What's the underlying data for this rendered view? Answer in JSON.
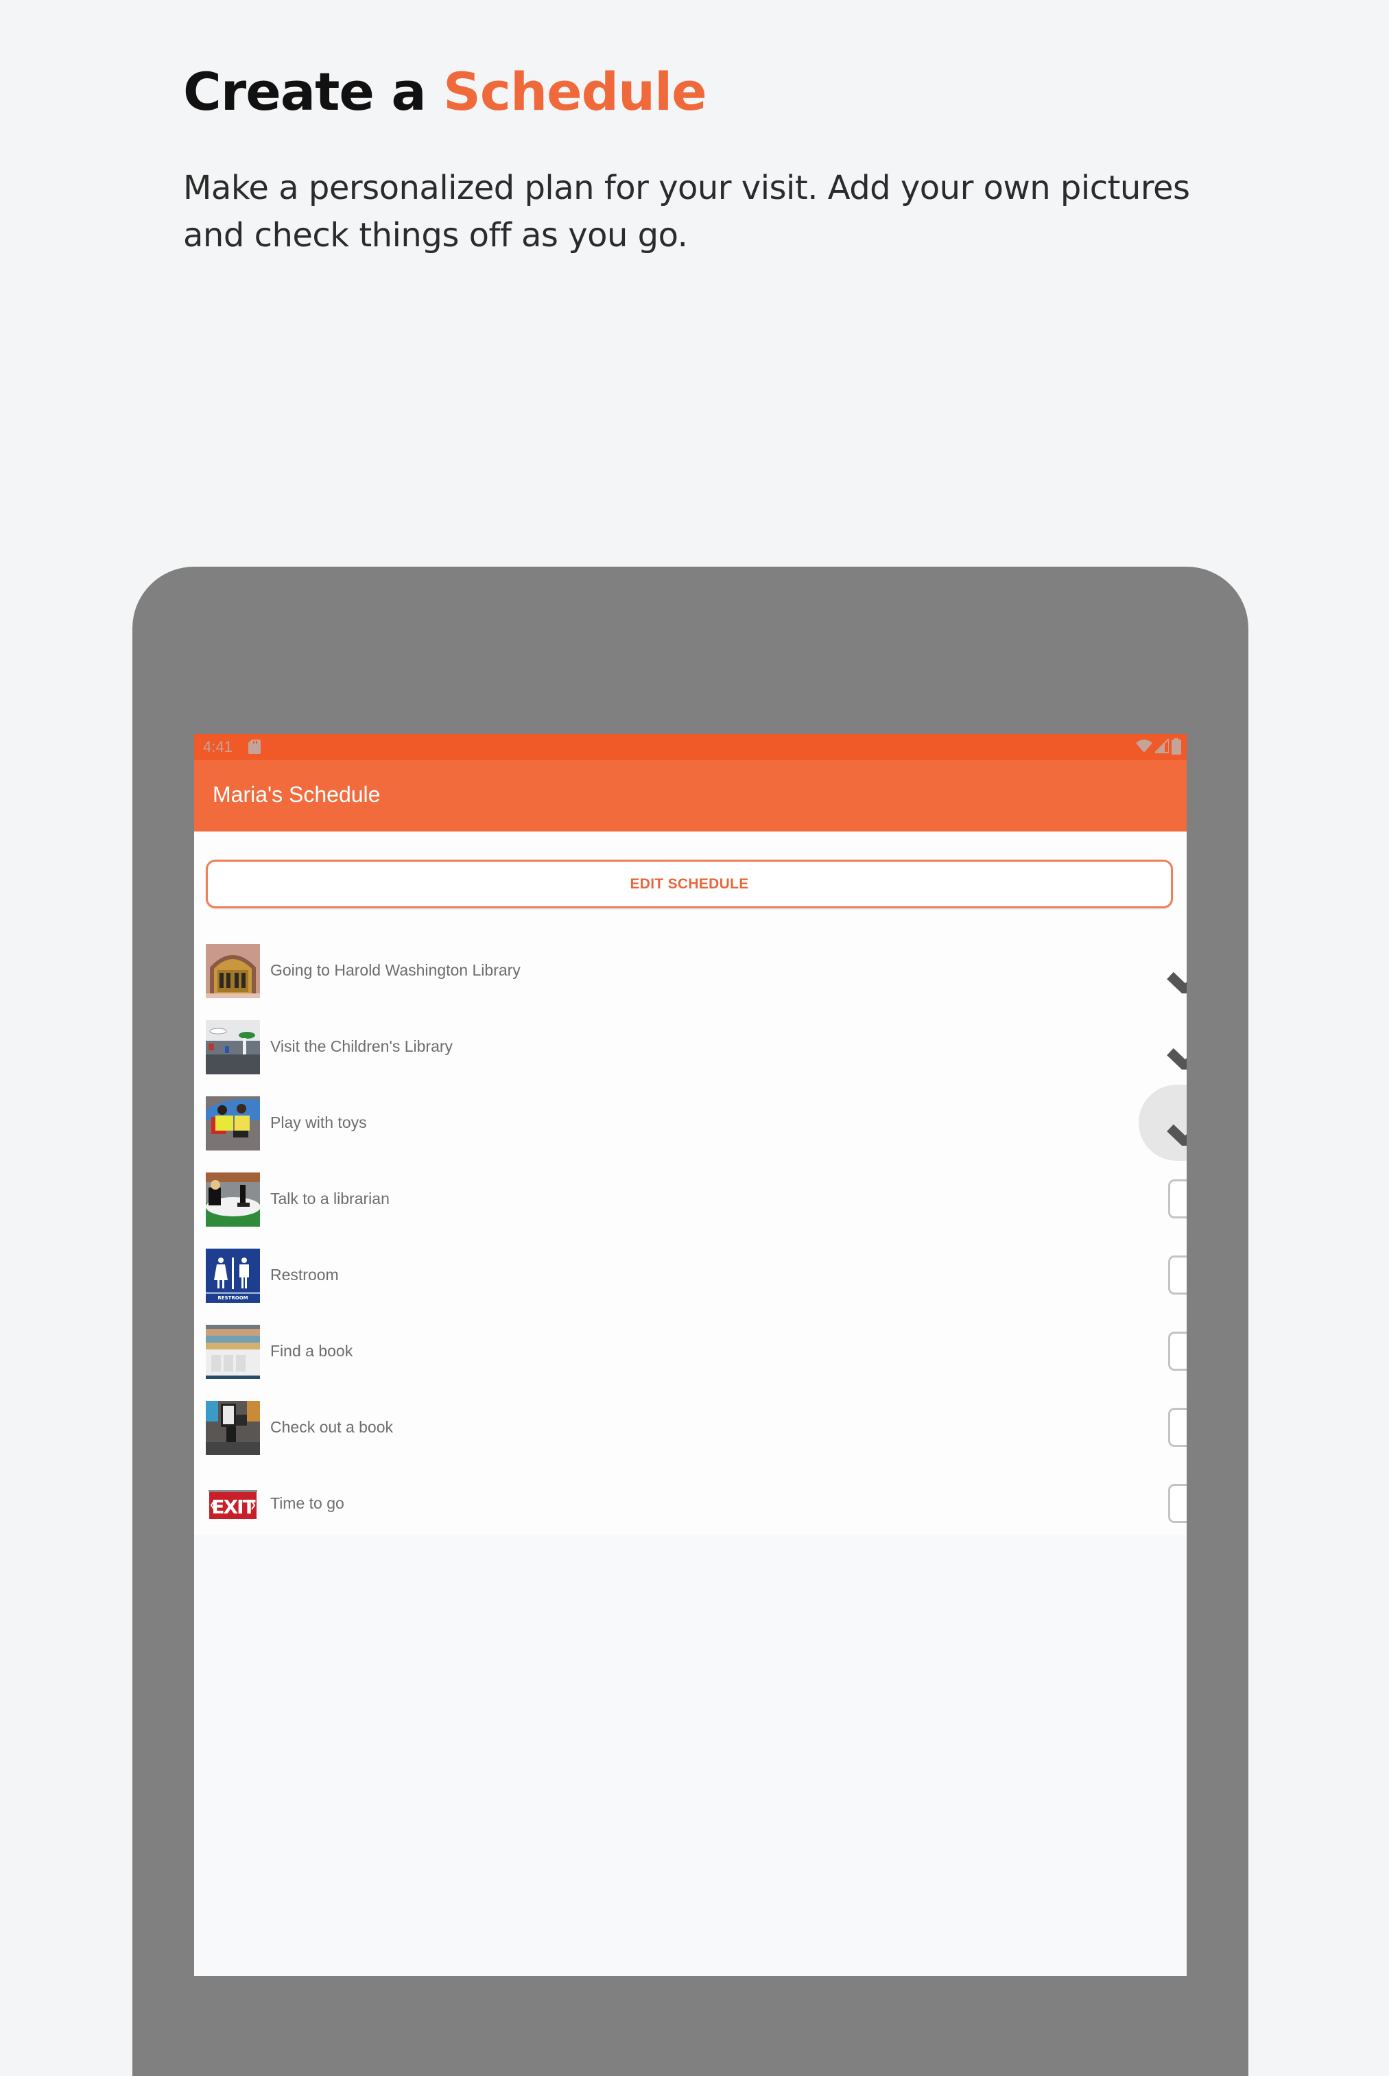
{
  "hero": {
    "title_prefix": "Create a ",
    "title_accent": "Schedule",
    "subtitle": "Make a personalized plan for your visit. Add your own pictures and check things off as you go."
  },
  "colors": {
    "accent": "#f0693a",
    "status_bar": "#f05a28",
    "app_bar": "#f26b3c",
    "device_frame": "#808080",
    "background": "#f4f5f7"
  },
  "status_bar": {
    "time": "4:41",
    "icons": [
      "sd-card-icon",
      "wifi-icon",
      "signal-icon",
      "battery-icon"
    ]
  },
  "app_bar": {
    "title": "Maria's Schedule"
  },
  "edit_button": {
    "label": "EDIT SCHEDULE"
  },
  "schedule": {
    "items": [
      {
        "label": "Going to Harold Washington Library",
        "image": "library-entrance-photo",
        "checked": true
      },
      {
        "label": "Visit the Children's Library",
        "image": "childrens-library-photo",
        "checked": true
      },
      {
        "label": "Play with toys",
        "image": "kids-playing-photo",
        "checked": true,
        "pressed": true
      },
      {
        "label": "Talk to a librarian",
        "image": "librarian-desk-photo",
        "checked": false
      },
      {
        "label": "Restroom",
        "image": "restroom-sign",
        "checked": false
      },
      {
        "label": "Find a book",
        "image": "book-shelves-photo",
        "checked": false
      },
      {
        "label": "Check out a book",
        "image": "self-checkout-kiosk-photo",
        "checked": false
      },
      {
        "label": "Time to go",
        "image": "exit-sign",
        "checked": false
      }
    ]
  },
  "restroom_sign_text": "RESTROOM",
  "exit_sign_text": "EXIT"
}
